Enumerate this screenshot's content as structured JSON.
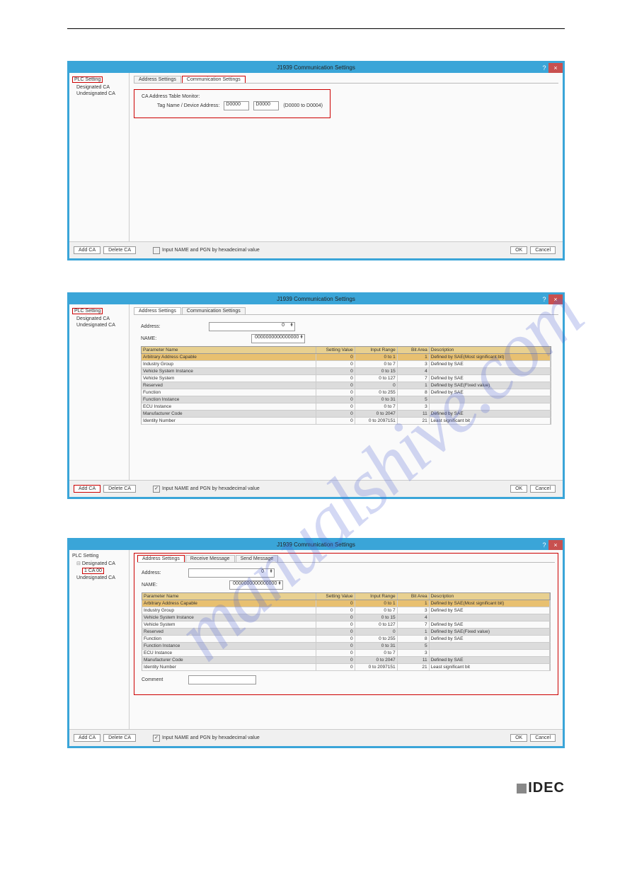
{
  "watermark": "manualshive.com",
  "dialog_title": "J1939 Communication Settings",
  "help_glyph": "?",
  "close_glyph": "×",
  "sidebar": {
    "root": "PLC Setting",
    "designated": "Designated CA",
    "undesignated": "Undesignated CA",
    "child": "1 CA 00"
  },
  "tabs": {
    "address": "Address Settings",
    "comm": "Communication Settings",
    "recv": "Receive Message",
    "send": "Send Message"
  },
  "comm_section": {
    "monitor_label": "CA Address Table Monitor:",
    "tag_label": "Tag Name / Device Address:",
    "field1": "D0000",
    "field2": "D0000",
    "range_hint": "(D0000 to D0004)"
  },
  "addr_section": {
    "address_label": "Address:",
    "address_value": "0",
    "name_label": "NAME:",
    "name_value": "0000000000000000"
  },
  "comment_label": "Comment",
  "table_headers": {
    "name": "Parameter Name",
    "val": "Setting Value",
    "range": "Input Range",
    "bit": "Bit Area",
    "desc": "Description"
  },
  "table_rows": [
    {
      "name": "Arbitrary Address Capable",
      "val": "0",
      "range": "0 to 1",
      "bit": "1",
      "desc": "Defined by SAE(Most significant bit)",
      "sel": true
    },
    {
      "name": "Industry Group",
      "val": "0",
      "range": "0 to 7",
      "bit": "3",
      "desc": "Defined by SAE"
    },
    {
      "name": "Vehicle System Instance",
      "val": "0",
      "range": "0 to 15",
      "bit": "4",
      "desc": ""
    },
    {
      "name": "Vehicle System",
      "val": "0",
      "range": "0 to 127",
      "bit": "7",
      "desc": "Defined by SAE"
    },
    {
      "name": "Reserved",
      "val": "0",
      "range": "0",
      "bit": "1",
      "desc": "Defined by SAE(Fixed value)"
    },
    {
      "name": "Function",
      "val": "0",
      "range": "0 to 255",
      "bit": "8",
      "desc": "Defined by SAE"
    },
    {
      "name": "Function Instance",
      "val": "0",
      "range": "0 to 31",
      "bit": "5",
      "desc": ""
    },
    {
      "name": "ECU Instance",
      "val": "0",
      "range": "0 to 7",
      "bit": "3",
      "desc": ""
    },
    {
      "name": "Manufacturer Code",
      "val": "0",
      "range": "0 to 2047",
      "bit": "11",
      "desc": "Defined by SAE"
    },
    {
      "name": "Identity Number",
      "val": "0",
      "range": "0 to 2097151",
      "bit": "21",
      "desc": "Least significant bit"
    }
  ],
  "footer": {
    "add": "Add CA",
    "del": "Delete CA",
    "hex": "Input NAME and PGN by hexadecimal value",
    "ok": "OK",
    "cancel": "Cancel"
  },
  "logo": "IDEC"
}
